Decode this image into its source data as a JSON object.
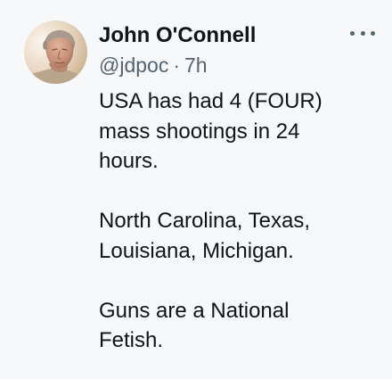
{
  "tweet": {
    "author_name": "John O'Connell",
    "handle": "@jdpoc",
    "separator": "·",
    "timestamp": "7h",
    "paragraphs": [
      [
        "USA has had 4 (FOUR)",
        "mass shootings in 24",
        "hours."
      ],
      [
        "North Carolina, Texas,",
        "Louisiana, Michigan."
      ],
      [
        "Guns are a National",
        "Fetish."
      ]
    ]
  },
  "icons": {
    "avatar": "profile-photo",
    "more": "more-options-icon"
  },
  "colors": {
    "background": "#f7f8f9",
    "text_primary": "#0f1419",
    "text_secondary": "#536471"
  }
}
